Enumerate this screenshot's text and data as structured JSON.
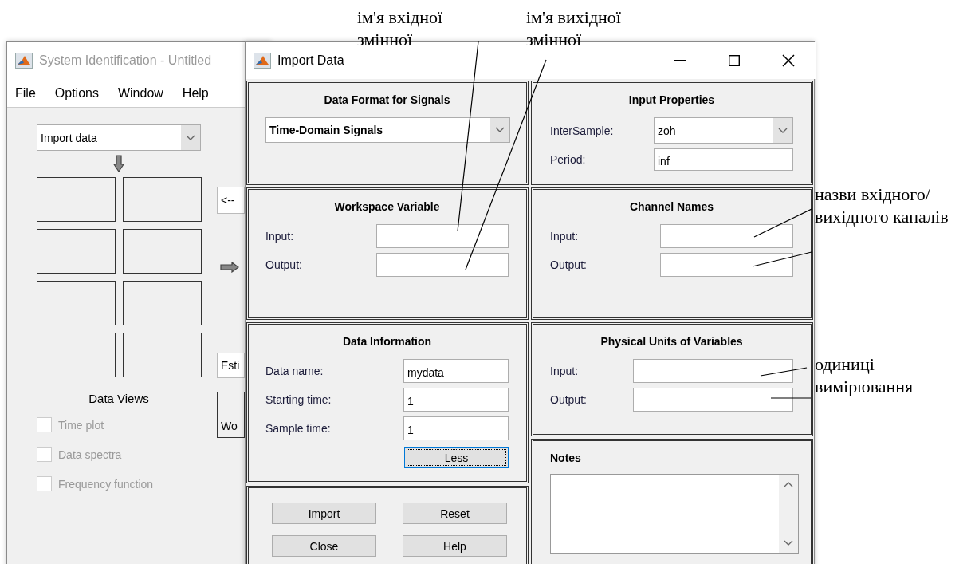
{
  "background_window": {
    "title": "System Identification - Untitled",
    "menu": [
      "File",
      "Options",
      "Window",
      "Help"
    ],
    "data_source_select": {
      "value": "Import data"
    },
    "data_views": {
      "title": "Data Views",
      "options": [
        {
          "label": "Time plot",
          "checked": false,
          "disabled": true
        },
        {
          "label": "Data spectra",
          "checked": false,
          "disabled": true
        },
        {
          "label": "Frequency function",
          "checked": false,
          "disabled": true
        }
      ]
    },
    "side_buttons": [
      "<--",
      "Esti",
      "Wo"
    ]
  },
  "dialog": {
    "title": "Import Data",
    "data_format": {
      "title": "Data Format for Signals",
      "select": {
        "value": "Time-Domain Signals"
      }
    },
    "workspace_variable": {
      "title": "Workspace Variable",
      "fields": [
        {
          "label": "Input:"
        },
        {
          "label": "Output:"
        }
      ]
    },
    "data_information": {
      "title": "Data Information",
      "fields": [
        {
          "label": "Data name:",
          "value": "mydata"
        },
        {
          "label": "Starting time:",
          "value": "1"
        },
        {
          "label": "Sample time:",
          "value": "1"
        }
      ],
      "less_button": {
        "label": "Less",
        "focused": true
      }
    },
    "buttons": [
      "Import",
      "Reset",
      "Close",
      "Help"
    ],
    "input_properties": {
      "title": "Input Properties",
      "intersample": {
        "label": "InterSample:",
        "value": "zoh"
      },
      "period": {
        "label": "Period:",
        "value": "inf"
      }
    },
    "channel_names": {
      "title": "Channel Names",
      "fields": [
        {
          "label": "Input:"
        },
        {
          "label": "Output:"
        }
      ]
    },
    "physical_units": {
      "title": "Physical Units of Variables",
      "fields": [
        {
          "label": "Input:"
        },
        {
          "label": "Output:"
        }
      ]
    },
    "notes": {
      "title": "Notes"
    }
  },
  "annotations": [
    {
      "text": "ім'я вхідної змінної"
    },
    {
      "text": "ім'я вихідної змінної"
    },
    {
      "text": "назви вхідного/вихідного каналів"
    },
    {
      "text": "одиниці вимірювання"
    }
  ]
}
